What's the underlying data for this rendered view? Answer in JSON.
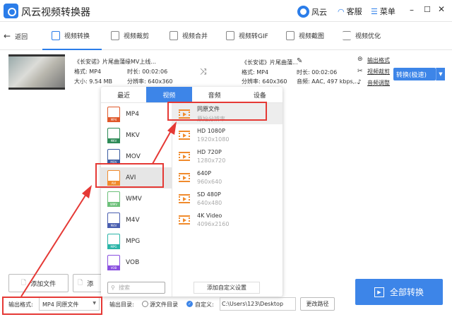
{
  "app": {
    "title": "风云视频转换器",
    "brand": "风云",
    "service": "客服",
    "menu": "菜单"
  },
  "nav": {
    "back": "返回",
    "tabs": [
      "视频转换",
      "视频裁剪",
      "视频合并",
      "视频转GIF",
      "视频截图",
      "视频优化"
    ],
    "active": "视频转换"
  },
  "file": {
    "source": {
      "name": "《长安诺》片尾曲蒲缘MV上线...",
      "format": "格式: MP4",
      "duration": "时长: 00:02:06",
      "size": "大小: 9.54 MB",
      "resolution": "分辨率: 640x360"
    },
    "target": {
      "name": "《长安诺》片尾曲蒲...",
      "format": "格式: MP4",
      "duration": "时长: 00:02:06",
      "resolution": "分辨率: 640x360",
      "audio": "音频: AAC, 497 kbps,..."
    },
    "actions": [
      "输出格式",
      "视频裁剪",
      "音频调整"
    ],
    "convert_label": "转换(极速)"
  },
  "popup": {
    "tabs": [
      "最近",
      "视频",
      "音频",
      "设备"
    ],
    "active_tab": "视频",
    "formats": [
      {
        "label": "MP4",
        "color": "#e0582a"
      },
      {
        "label": "MKV",
        "color": "#2e8b57"
      },
      {
        "label": "MOV",
        "color": "#3a5ba0"
      },
      {
        "label": "AVI",
        "color": "#f08a2c"
      },
      {
        "label": "WMV",
        "color": "#6cc07a"
      },
      {
        "label": "M4V",
        "color": "#4a5fb0"
      },
      {
        "label": "MPG",
        "color": "#2bb5a8"
      },
      {
        "label": "VOB",
        "color": "#8a4fe0"
      }
    ],
    "selected_format": "AVI",
    "resolutions": [
      {
        "title": "同原文件",
        "sub": "原始分辨率"
      },
      {
        "title": "HD 1080P",
        "sub": "1920x1080"
      },
      {
        "title": "HD 720P",
        "sub": "1280x720"
      },
      {
        "title": "640P",
        "sub": "960x640"
      },
      {
        "title": "SD 480P",
        "sub": "640x480"
      },
      {
        "title": "4K Video",
        "sub": "4096x2160"
      }
    ],
    "search_placeholder": "搜索",
    "custom_label": "添加自定义设置"
  },
  "bottom": {
    "add_file": "添加文件",
    "add_folder": "添",
    "output_format_label": "输出格式:",
    "output_format_value": "MP4 同原文件",
    "output_dir_label": "输出目录:",
    "source_dir": "源文件目录",
    "custom_dir": "自定义:",
    "path": "C:\\Users\\123\\Desktop",
    "change_path": "更改路径",
    "convert_all": "全部转换"
  },
  "colors": {
    "accent": "#3d85e8",
    "annotation": "#e53935"
  }
}
